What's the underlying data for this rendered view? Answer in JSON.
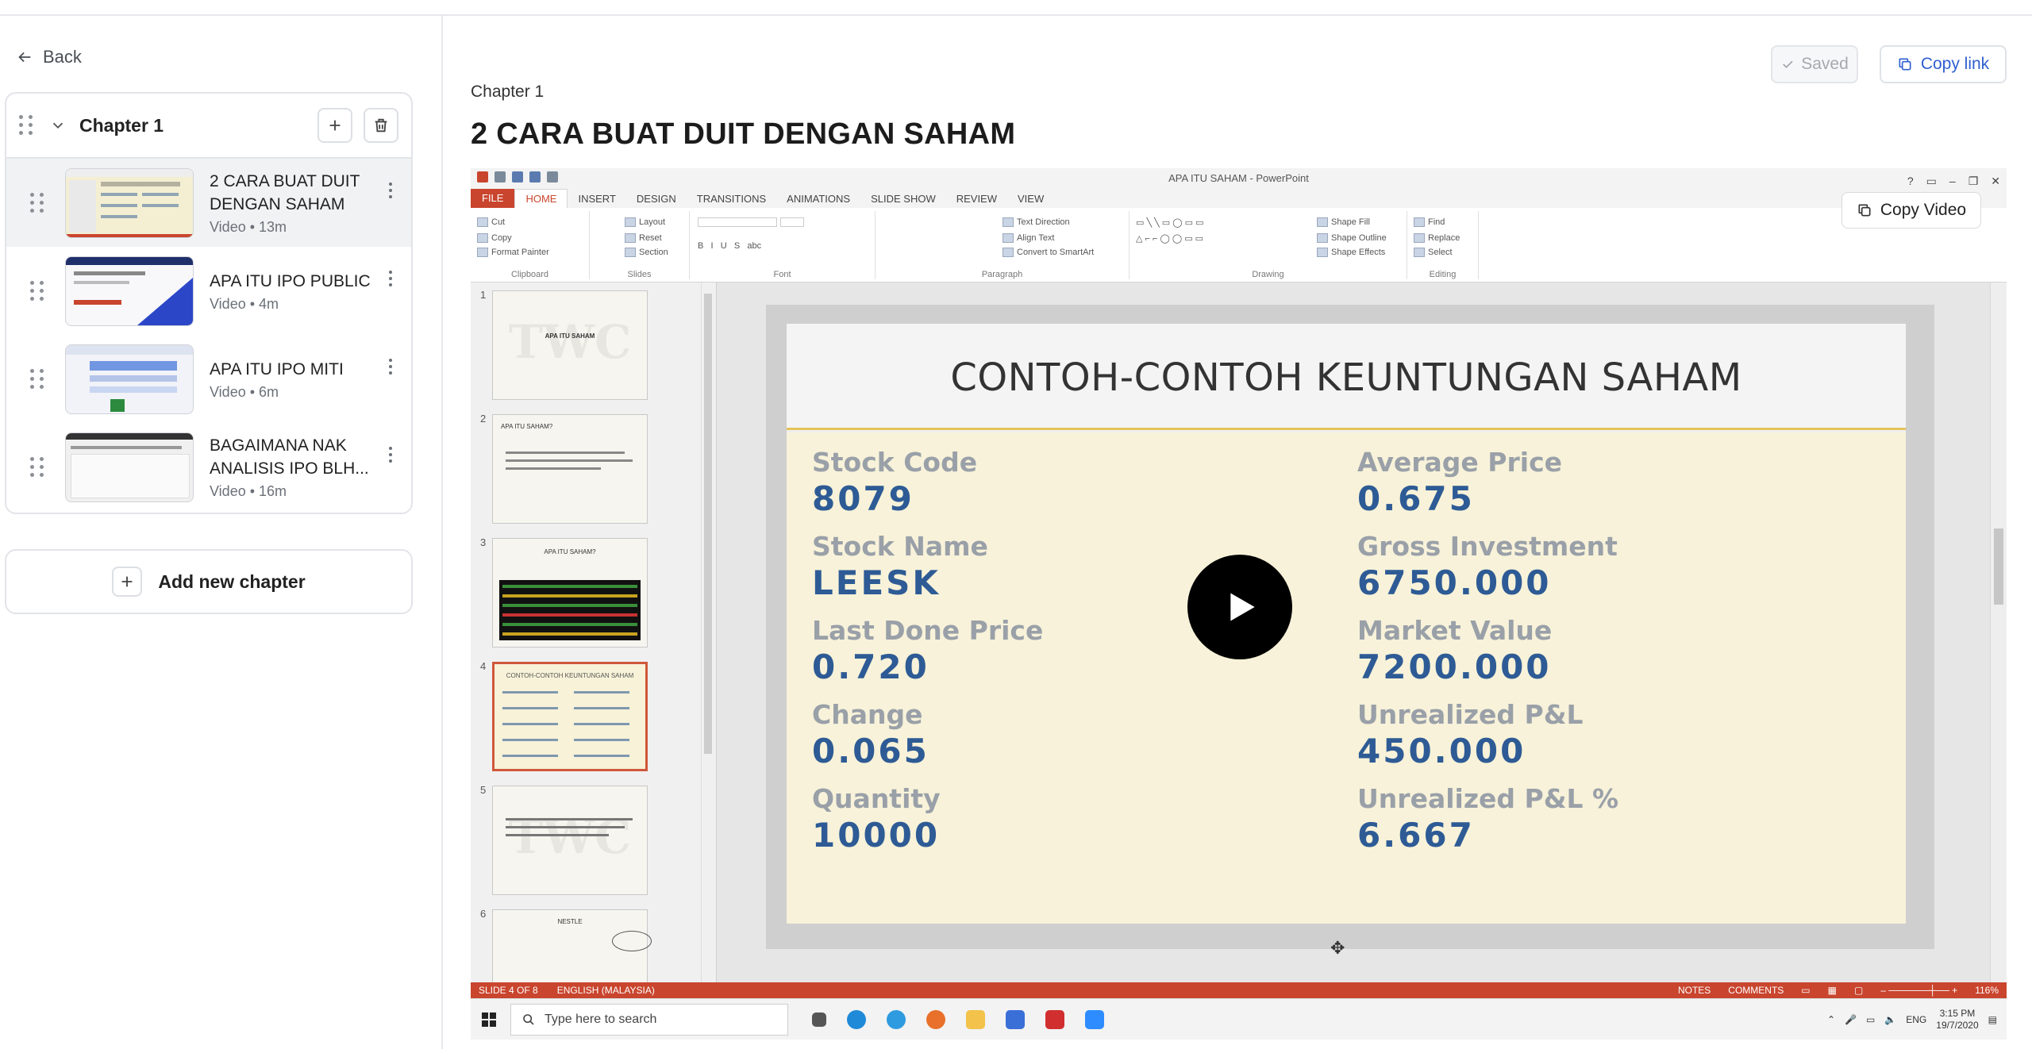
{
  "nav": {
    "back_label": "Back"
  },
  "chapter": {
    "title": "Chapter 1",
    "lessons": [
      {
        "title": "2 CARA BUAT DUIT DENGAN SAHAM",
        "meta": "Video • 13m",
        "active": true
      },
      {
        "title": "APA ITU IPO PUBLIC",
        "meta": "Video • 4m",
        "active": false
      },
      {
        "title": "APA ITU IPO MITI",
        "meta": "Video • 6m",
        "active": false
      },
      {
        "title": "BAGAIMANA NAK ANALISIS IPO BLH...",
        "meta": "Video • 16m",
        "active": false
      }
    ]
  },
  "add_chapter_label": "Add new chapter",
  "header": {
    "saved_label": "Saved",
    "copy_link_label": "Copy link",
    "crumb": "Chapter 1",
    "title": "2 CARA BUAT DUIT DENGAN SAHAM"
  },
  "video": {
    "copy_video_label": "Copy Video",
    "window_title": "APA ITU SAHAM - PowerPoint",
    "ribbon_tabs": [
      "FILE",
      "HOME",
      "INSERT",
      "DESIGN",
      "TRANSITIONS",
      "ANIMATIONS",
      "SLIDE SHOW",
      "REVIEW",
      "VIEW"
    ],
    "active_tab": "HOME",
    "ribbon_groups": [
      "Clipboard",
      "Slides",
      "Font",
      "Paragraph",
      "Drawing",
      "Editing"
    ],
    "slide_numbers": [
      "1",
      "2",
      "3",
      "4",
      "5",
      "6"
    ],
    "thumb_texts": {
      "s1": "APA ITU SAHAM",
      "s2": "APA ITU SAHAM?",
      "s3": "APA ITU SAHAM?",
      "s4": "CONTOH-CONTOH KEUNTUNGAN SAHAM",
      "s6": "NESTLE"
    },
    "slide": {
      "title": "CONTOH-CONTOH KEUNTUNGAN  SAHAM",
      "left": [
        {
          "label": "Stock Code",
          "value": "8079"
        },
        {
          "label": "Stock Name",
          "value": "LEESK"
        },
        {
          "label": "Last Done Price",
          "value": "0.720"
        },
        {
          "label": "Change",
          "value": "0.065"
        },
        {
          "label": "Quantity",
          "value": "10000"
        }
      ],
      "right": [
        {
          "label": "Average Price",
          "value": "0.675"
        },
        {
          "label": "Gross Investment",
          "value": "6750.000"
        },
        {
          "label": "Market Value",
          "value": "7200.000"
        },
        {
          "label": "Unrealized P&L",
          "value": "450.000"
        },
        {
          "label": "Unrealized P&L %",
          "value": "6.667"
        }
      ]
    },
    "status": {
      "slide_info": "SLIDE 4 OF 8",
      "language": "ENGLISH (MALAYSIA)",
      "notes": "NOTES",
      "comments": "COMMENTS",
      "zoom": "116%"
    },
    "taskbar": {
      "search_placeholder": "Type here to search",
      "lang": "ENG",
      "time": "3:15 PM",
      "date": "19/7/2020"
    }
  },
  "colors": {
    "accent": "#2f5fd0",
    "ppt_red": "#c9452e",
    "slide_value": "#2e5b95"
  }
}
